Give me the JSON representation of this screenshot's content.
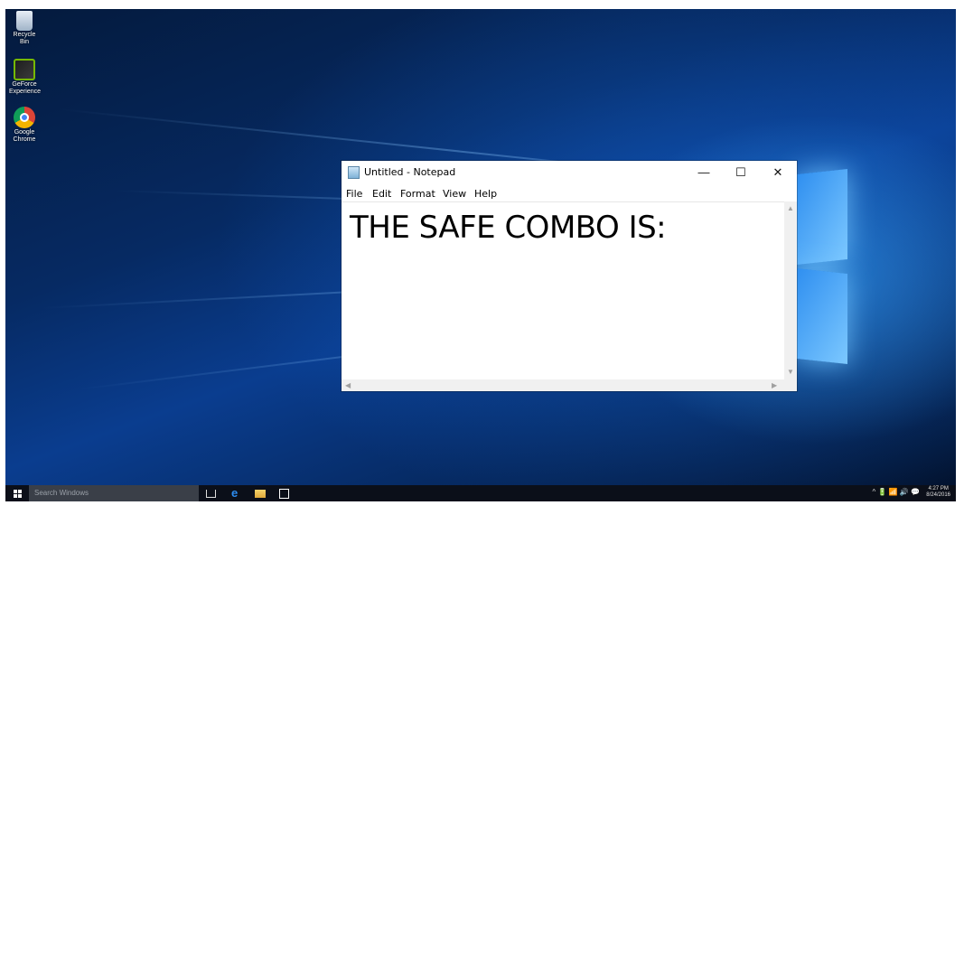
{
  "desktop": {
    "icons": [
      {
        "label": "Recycle Bin",
        "icon": "recycle-bin-icon"
      },
      {
        "label": "GeForce Experience",
        "icon": "geforce-icon"
      },
      {
        "label": "Google Chrome",
        "icon": "chrome-icon"
      }
    ]
  },
  "notepad": {
    "title": "Untitled - Notepad",
    "menu": [
      "File",
      "Edit",
      "Format",
      "View",
      "Help"
    ],
    "content": "THE SAFE COMBO IS:",
    "buttons": {
      "minimize": "—",
      "maximize": "☐",
      "close": "✕"
    }
  },
  "taskbar": {
    "search_placeholder": "Search Windows",
    "tray": "^ 🔋 📶 🔊 💬",
    "clock_time": "4:27 PM",
    "clock_date": "8/24/2016"
  },
  "colors": {
    "taskbar": "#0b0f19",
    "window_bg": "#ffffff",
    "desktop_accent": "#2f8ff0"
  }
}
